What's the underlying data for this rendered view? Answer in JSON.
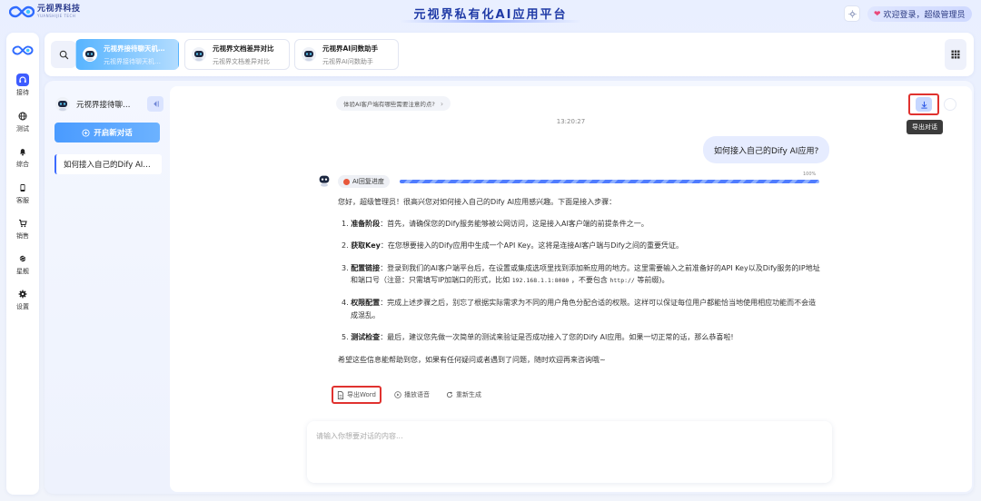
{
  "header": {
    "logo_name": "元视界科技",
    "logo_sub": "YUANSHIJIE TECH",
    "app_title": "元视界私有化AI应用平台",
    "user_greeting": "欢迎登录，超级管理员",
    "accent_color": "#3d5cff"
  },
  "nav": {
    "items": [
      {
        "label": "接待",
        "icon": "headset-icon",
        "active": true
      },
      {
        "label": "测试",
        "icon": "globe-icon",
        "active": false
      },
      {
        "label": "综合",
        "icon": "bell-icon",
        "active": false
      },
      {
        "label": "客服",
        "icon": "phone-icon",
        "active": false
      },
      {
        "label": "销售",
        "icon": "cart-icon",
        "active": false
      },
      {
        "label": "星舰",
        "icon": "planet-icon",
        "active": false
      },
      {
        "label": "设置",
        "icon": "gear-icon",
        "active": false
      }
    ]
  },
  "tabs": [
    {
      "title": "元视界接待聊天机…",
      "subtitle": "元视界接待聊天机…",
      "active": true
    },
    {
      "title": "元视界文档差异对比",
      "subtitle": "元视界文档差异对比",
      "active": false
    },
    {
      "title": "元视界AI问数助手",
      "subtitle": "元视界AI问数助手",
      "active": false
    }
  ],
  "sidebar": {
    "title": "元视界接待聊…",
    "new_chat": "开启新对话",
    "conversations": [
      "如何接入自己的Dify AI…"
    ]
  },
  "chat": {
    "suggestion": "体验AI客户端有哪些需要注意的点?",
    "timestamp": "13:20:27",
    "export_tooltip": "导出对话",
    "user_message": "如何接入自己的Dify AI应用?",
    "progress_label": "AI回复进度",
    "progress_value": 100,
    "progress_pct": "100%",
    "answer": {
      "intro": "您好，超级管理员！很高兴您对如何接入自己的Dify AI应用感兴趣。下面是接入步骤：",
      "steps": [
        {
          "num": "1.",
          "title": "准备阶段",
          "text": "：首先，请确保您的Dify服务能够被公网访问，这是接入AI客户端的前提条件之一。"
        },
        {
          "num": "2.",
          "title": "获取Key",
          "text": "：在您想要接入的Dify应用中生成一个API Key。这将是连接AI客户端与Dify之间的重要凭证。"
        },
        {
          "num": "3.",
          "title": "配置链接",
          "text_a": "：登录到我们的AI客户端平台后，在设置或集成选项里找到添加新应用的地方。这里需要输入之前准备好的API Key以及Dify服务的IP地址和端口号（注意：只需填写IP加端口的形式，比如 ",
          "code_a": "192.168.1.1:8080",
          "text_b": " ，不要包含 ",
          "code_b": "http://",
          "text_c": " 等前缀)。"
        },
        {
          "num": "4.",
          "title": "权限配置",
          "text": "：完成上述步骤之后，别忘了根据实际需求为不同的用户角色分配合适的权限。这样可以保证每位用户都能恰当地使用相应功能而不会造成混乱。"
        },
        {
          "num": "5.",
          "title": "测试检查",
          "text": "：最后，建议您先做一次简单的测试来验证是否成功接入了您的Dify AI应用。如果一切正常的话，那么恭喜啦!"
        }
      ],
      "outro": "希望这些信息能帮助到您，如果有任何疑问或者遇到了问题，随时欢迎再来咨询哦~"
    },
    "actions": {
      "export_word": "导出Word",
      "play_audio": "播放语音",
      "regenerate": "重新生成"
    },
    "input_placeholder": "请输入你想要对话的内容..."
  }
}
